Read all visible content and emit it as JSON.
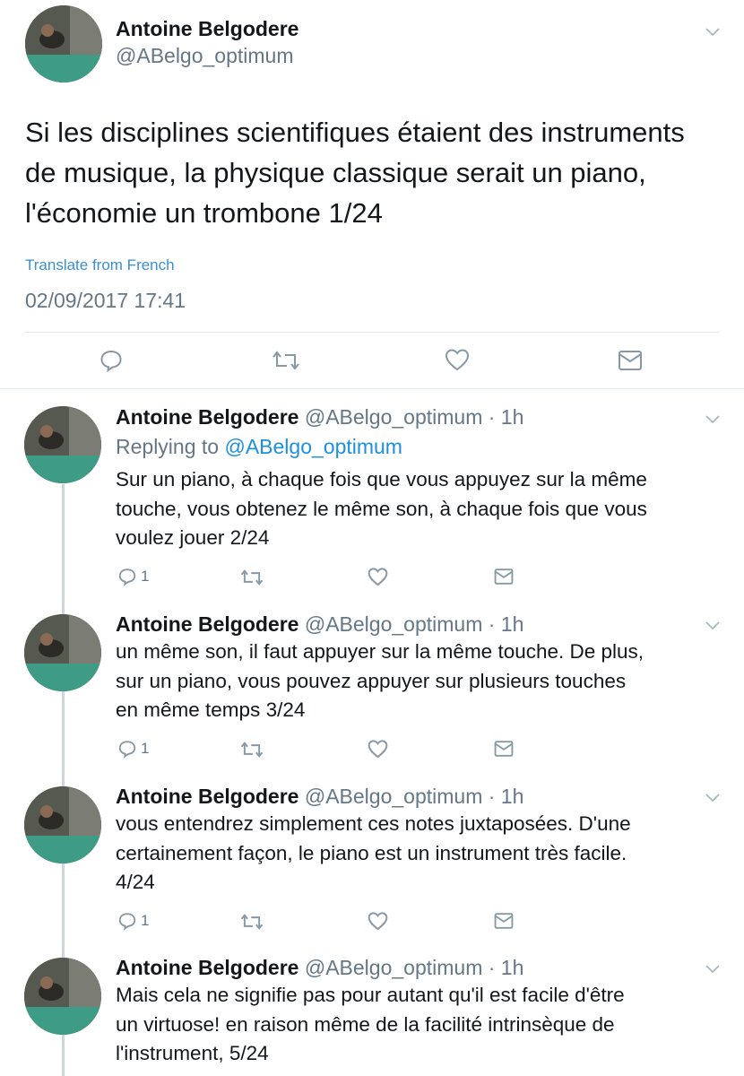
{
  "main_tweet": {
    "author_name": "Antoine Belgodere",
    "handle": "@ABelgo_optimum",
    "text_lines": [
      "Si les disciplines scientifiques étaient des instruments",
      "de musique, la physique classique serait un piano,",
      "l'économie un trombone 1/24"
    ],
    "translate_label": "Translate from French",
    "timestamp": "02/09/2017 17:41"
  },
  "replies": [
    {
      "author_name": "Antoine Belgodere",
      "handle_time": "@ABelgo_optimum · 1h",
      "replying_prefix": "Replying to ",
      "replying_handle": "@ABelgo_optimum",
      "text_lines": [
        "Sur un piano, à chaque fois que vous appuyez sur la même",
        "touche, vous obtenez le même son, à chaque fois que vous",
        "voulez jouer 2/24"
      ],
      "reply_count": "1"
    },
    {
      "author_name": "Antoine Belgodere",
      "handle_time": "@ABelgo_optimum · 1h",
      "text_lines": [
        "un même son, il faut appuyer sur la même touche. De plus,",
        "sur un piano, vous pouvez appuyer sur plusieurs touches",
        "en même temps 3/24"
      ],
      "reply_count": "1"
    },
    {
      "author_name": "Antoine Belgodere",
      "handle_time": "@ABelgo_optimum · 1h",
      "text_lines": [
        "vous entendrez simplement ces notes juxtaposées. D'une",
        "certainement façon, le piano est un instrument très facile.",
        "4/24"
      ],
      "reply_count": "1"
    },
    {
      "author_name": "Antoine Belgodere",
      "handle_time": "@ABelgo_optimum · 1h",
      "text_lines": [
        "Mais cela ne signifie pas pour autant qu'il est facile d'être",
        "un virtuose! en raison même de la facilité intrinsèque de",
        "l'instrument, 5/24"
      ]
    }
  ],
  "icons": [
    "chevron-down-icon",
    "reply-icon",
    "retweet-icon",
    "like-icon",
    "message-icon"
  ],
  "colors": {
    "link": "#1d8fe0",
    "muted": "#657786",
    "icon": "#8899a6",
    "divider": "#e1e8ed"
  }
}
